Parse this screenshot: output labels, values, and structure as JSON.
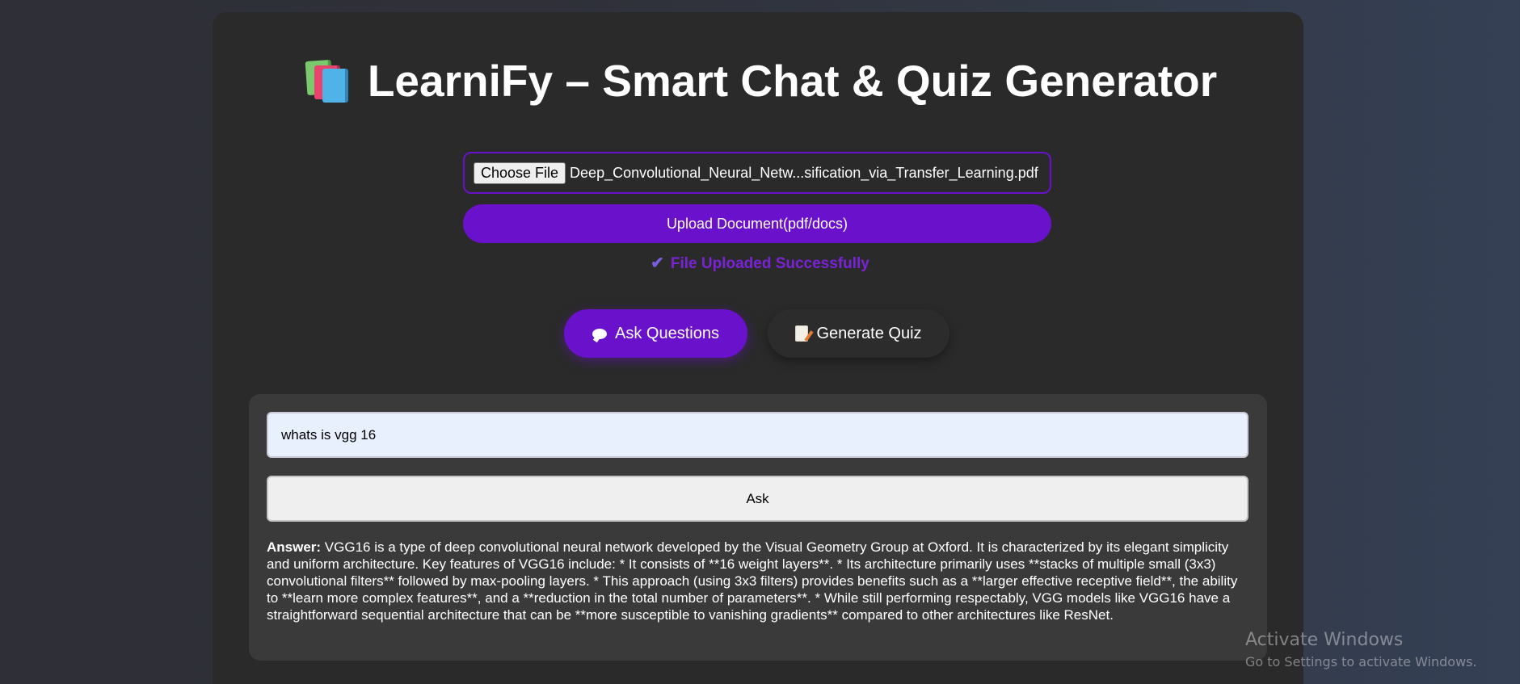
{
  "header": {
    "title": "LearniFy – Smart Chat & Quiz Generator",
    "icon": "books-icon"
  },
  "upload": {
    "choose_file_label": "Choose File",
    "file_name": "Deep_Convolutional_Neural_Netw...sification_via_Transfer_Learning.pdf",
    "upload_button_label": "Upload Document(pdf/docs)",
    "status_text": "File Uploaded Successfully",
    "status_icon": "checkmark-icon",
    "status_color": "#7a23d6"
  },
  "tabs": [
    {
      "label": "Ask Questions",
      "icon": "speech-balloon-icon",
      "active": true
    },
    {
      "label": "Generate Quiz",
      "icon": "memo-icon",
      "active": false
    }
  ],
  "qa": {
    "question_value": "whats is vgg 16",
    "ask_button_label": "Ask",
    "answer_label": "Answer:",
    "answer_text": " VGG16 is a type of deep convolutional neural network developed by the Visual Geometry Group at Oxford. It is characterized by its elegant simplicity and uniform architecture. Key features of VGG16 include: * It consists of **16 weight layers**. * Its architecture primarily uses **stacks of multiple small (3x3) convolutional filters** followed by max-pooling layers. * This approach (using 3x3 filters) provides benefits such as a **larger effective receptive field**, the ability to **learn more complex features**, and a **reduction in the total number of parameters**. * While still performing respectably, VGG models like VGG16 have a straightforward sequential architecture that can be **more susceptible to vanishing gradients** compared to other architectures like ResNet."
  },
  "watermark": {
    "title": "Activate Windows",
    "subtitle": "Go to Settings to activate Windows."
  },
  "colors": {
    "accent": "#6a11cb",
    "card_background": "#2a2a2a",
    "panel_background": "#3a3a3a"
  }
}
